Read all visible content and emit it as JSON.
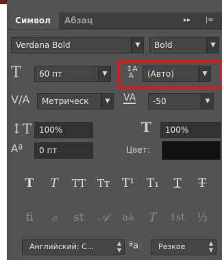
{
  "tabs": {
    "character": "Символ",
    "paragraph": "Абзац"
  },
  "toolbar": {
    "expand_glyph": "▸▸",
    "menu_glyph": "|≡"
  },
  "font": {
    "family": "Verdana Bold",
    "style": "Bold"
  },
  "size": {
    "font_size": "60 пт",
    "leading": "(Авто)"
  },
  "spacing": {
    "kerning": "Метрическ",
    "tracking": "-50"
  },
  "scale": {
    "vertical": "100%",
    "horizontal": "100%"
  },
  "baseline": {
    "shift": "0 пт"
  },
  "color": {
    "label": "Цвет:",
    "swatch": "#111111"
  },
  "type_styles": [
    {
      "name": "bold",
      "glyph": "T"
    },
    {
      "name": "italic",
      "glyph": "T"
    },
    {
      "name": "all-caps",
      "glyph": "TT"
    },
    {
      "name": "small-caps",
      "glyph": "Tт"
    },
    {
      "name": "superscript",
      "glyph": "T¹"
    },
    {
      "name": "subscript",
      "glyph": "T₁"
    },
    {
      "name": "underline",
      "glyph": "T"
    },
    {
      "name": "strikethrough",
      "glyph": "T"
    }
  ],
  "opentype": [
    {
      "name": "ligatures",
      "glyph": "fi"
    },
    {
      "name": "swash",
      "glyph": "ℴ"
    },
    {
      "name": "discretionary-ligatures",
      "glyph": "st"
    },
    {
      "name": "stylistic-alternates",
      "glyph": "𝒜"
    },
    {
      "name": "titling-alternates",
      "glyph": "aā"
    },
    {
      "name": "titling-t",
      "glyph": "T"
    },
    {
      "name": "ordinals",
      "glyph": "1st"
    },
    {
      "name": "fractions",
      "glyph": "½"
    }
  ],
  "language": {
    "value": "Английский: С...",
    "aa_glyph": "ªa",
    "antialias": "Резкое"
  }
}
